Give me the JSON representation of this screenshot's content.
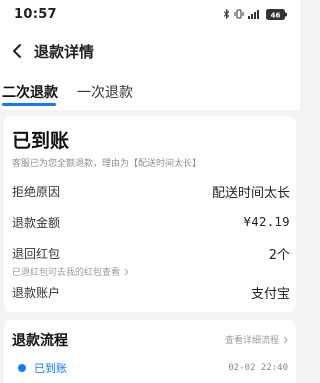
{
  "status_bar": {
    "time": "10:57",
    "battery_level": "46"
  },
  "nav": {
    "title": "退款详情",
    "back_icon": "chevron-left-icon"
  },
  "tabs": [
    {
      "label": "二次退款",
      "active": true
    },
    {
      "label": "一次退款",
      "active": false
    }
  ],
  "detail": {
    "status_title": "已到账",
    "status_desc": "客服已为您全额退款，理由为【配送时间太长】",
    "rows": [
      {
        "label": "拒绝原因",
        "value": "配送时间太长"
      },
      {
        "label": "退款金额",
        "value": "¥42.19"
      },
      {
        "label": "退回红包",
        "value": "2个"
      },
      {
        "label": "退款账户",
        "value": "支付宝"
      }
    ],
    "hongbao_hint": "已退红包可去我的红包查看"
  },
  "process": {
    "title": "退款流程",
    "link": "查看详细流程",
    "steps": [
      {
        "label": "已到账",
        "time": "02-02 22:40"
      }
    ]
  },
  "colors": {
    "accent": "#1678ff",
    "background": "#f2f3f5",
    "card": "#ffffff",
    "muted_text": "#8e8e93"
  }
}
